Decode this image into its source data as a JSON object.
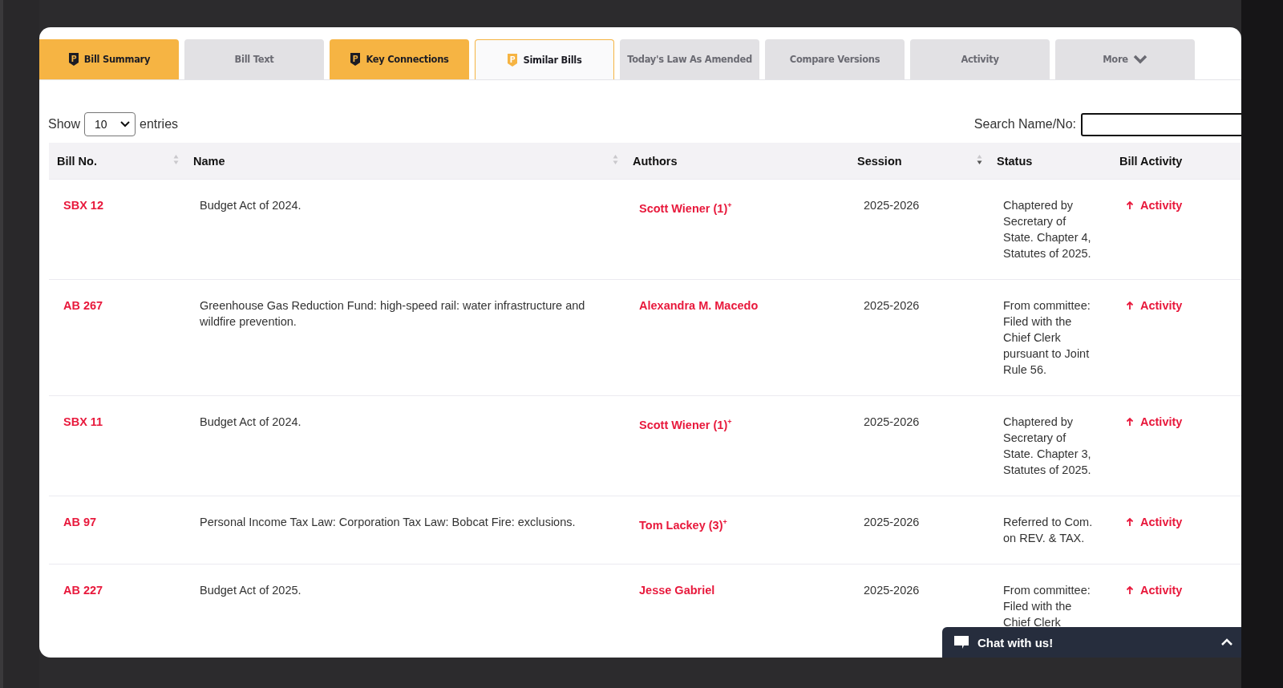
{
  "tabs": [
    {
      "label": "Bill Summary",
      "featured": true,
      "selected": false
    },
    {
      "label": "Bill Text",
      "featured": false,
      "selected": false
    },
    {
      "label": "Key Connections",
      "featured": true,
      "selected": false
    },
    {
      "label": "Similar Bills",
      "featured": true,
      "selected": true
    },
    {
      "label": "Today's Law As Amended",
      "featured": false,
      "selected": false
    },
    {
      "label": "Compare Versions",
      "featured": false,
      "selected": false
    },
    {
      "label": "Activity",
      "featured": false,
      "selected": false
    },
    {
      "label": "More",
      "featured": false,
      "selected": false,
      "dropdown": true
    }
  ],
  "length_control": {
    "prefix": "Show",
    "value": "10",
    "suffix": "entries"
  },
  "search": {
    "label": "Search Name/No:"
  },
  "table": {
    "columns": [
      {
        "label": "Bill No.",
        "sortable": true,
        "sorted_desc": false
      },
      {
        "label": "Name",
        "sortable": true,
        "sorted_desc": false
      },
      {
        "label": "Authors"
      },
      {
        "label": "Session",
        "sortable": true,
        "sorted_desc": true
      },
      {
        "label": "Status"
      },
      {
        "label": "Bill Activity"
      }
    ],
    "rows": [
      {
        "bill_no": "SBX 12",
        "name": "Budget Act of 2024.",
        "authors": "Scott Wiener (1)$^{+}$",
        "session": "2025-2026",
        "status": "Chaptered by Secretary of State. Chapter 4, Statutes of 2025.",
        "activity": "Activity"
      },
      {
        "bill_no": "AB 267",
        "name": "Greenhouse Gas Reduction Fund: high-speed rail: water infrastructure and wildfire prevention.",
        "authors": "Alexandra M. Macedo",
        "session": "2025-2026",
        "status": "From committee: Filed with the Chief Clerk pursuant to Joint Rule 56.",
        "activity": "Activity"
      },
      {
        "bill_no": "SBX 11",
        "name": "Budget Act of 2024.",
        "authors": "Scott Wiener (1)$^{+}$",
        "session": "2025-2026",
        "status": "Chaptered by Secretary of State. Chapter 3, Statutes of 2025.",
        "activity": "Activity"
      },
      {
        "bill_no": "AB 97",
        "name": "Personal Income Tax Law: Corporation Tax Law: Bobcat Fire: exclusions.",
        "authors": "Tom Lackey (3)$^{+}$",
        "session": "2025-2026",
        "status": "Referred to Com. on REV. & TAX.",
        "activity": "Activity"
      },
      {
        "bill_no": "AB 227",
        "name": "Budget Act of 2025.",
        "authors": "Jesse Gabriel",
        "session": "2025-2026",
        "status": "From committee: Filed with the Chief Clerk",
        "activity": "Activity"
      }
    ]
  },
  "chat": {
    "label": "Chat with us!"
  }
}
